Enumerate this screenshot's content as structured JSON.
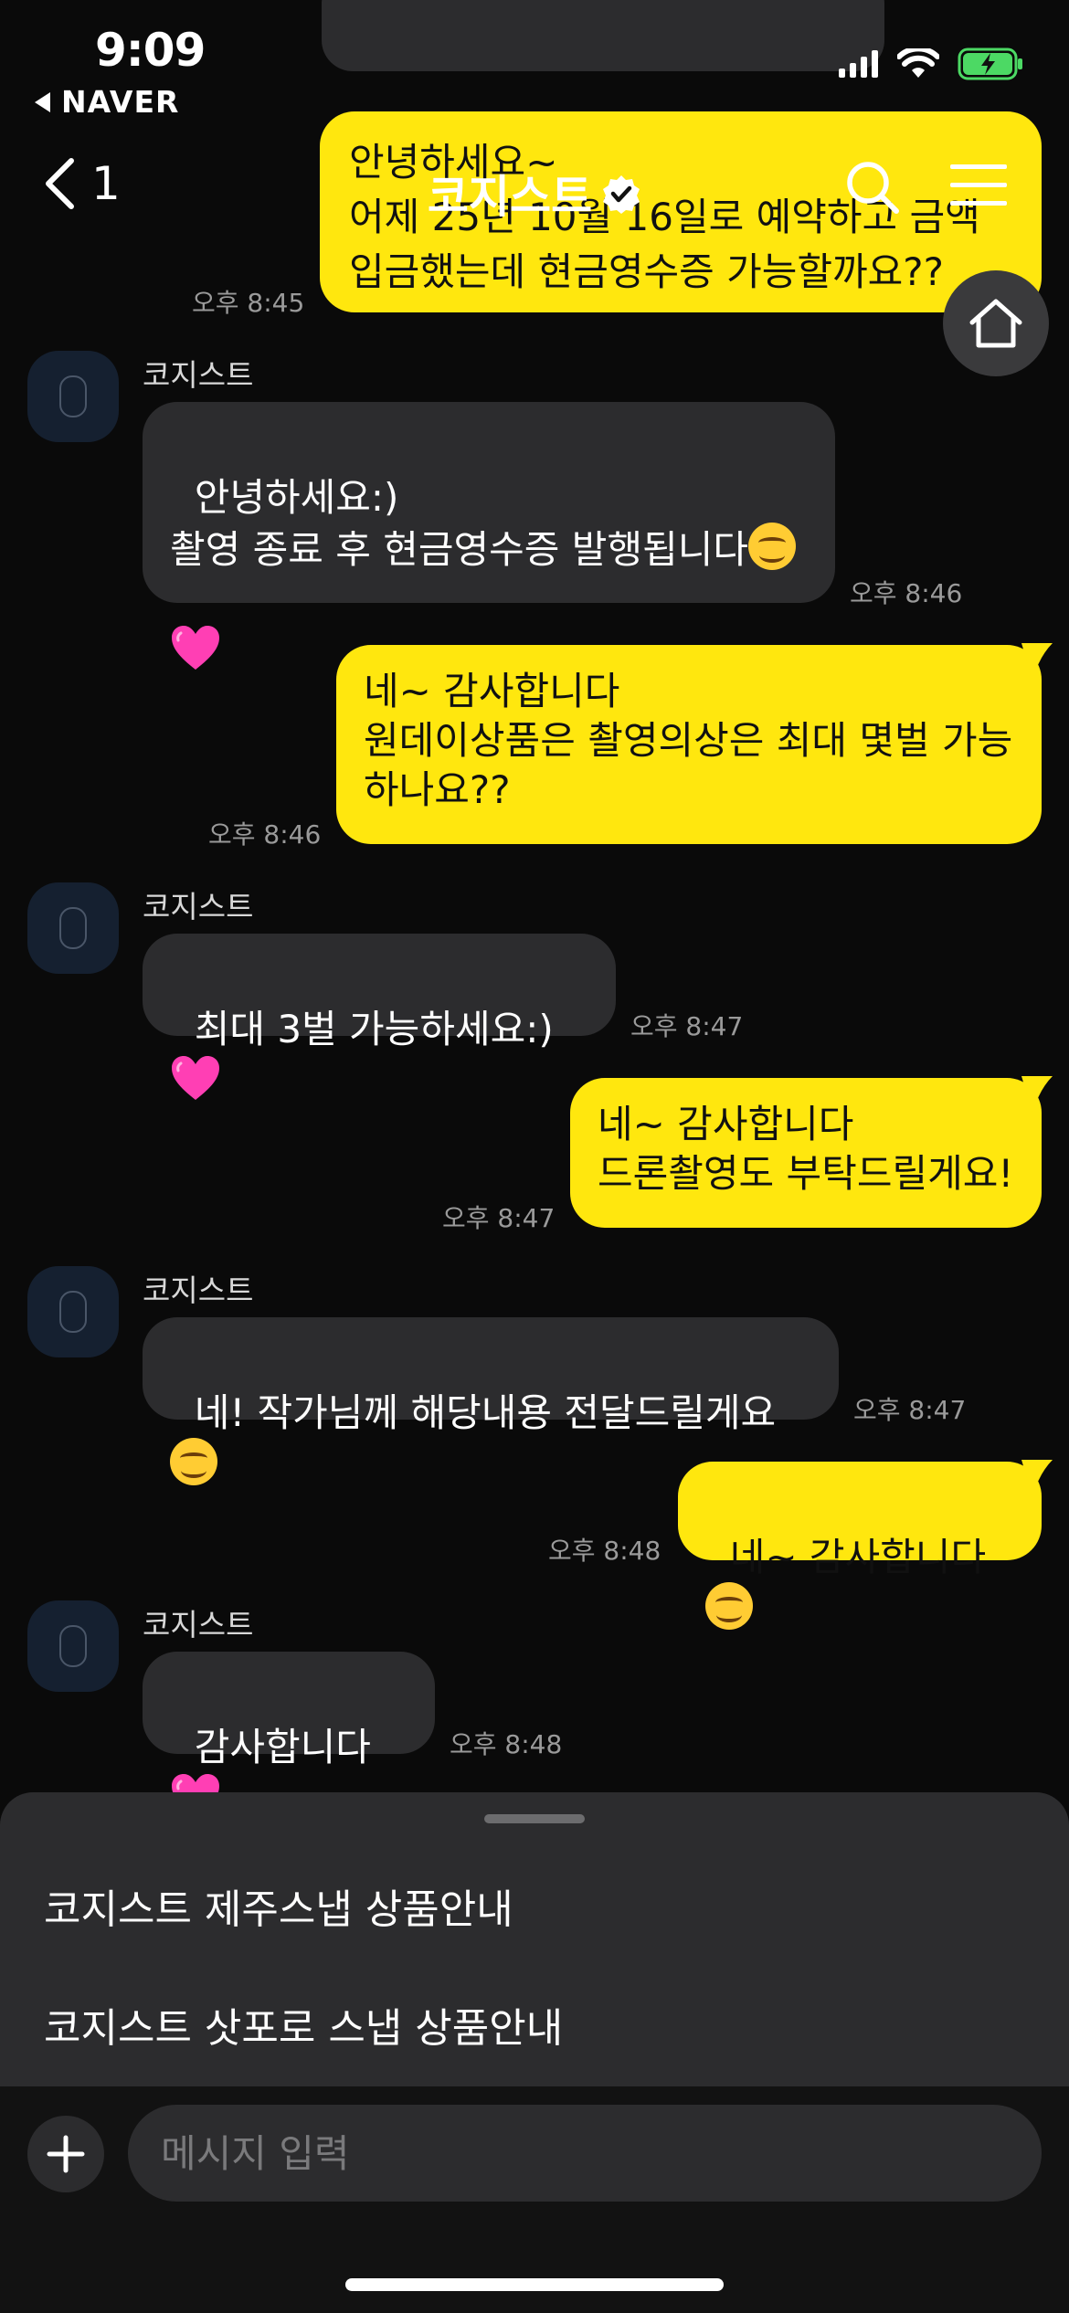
{
  "status": {
    "time": "9:09",
    "back_app": "NAVER"
  },
  "nav": {
    "back_count": "1",
    "title": "코지스트"
  },
  "messages": [
    {
      "text": "안녕하세요~\n어제 25년 10월 16일로 예약하고 금액입금했는데 현금영수증 가능할까요??",
      "time": "오후 8:45"
    },
    {
      "sender": "코지스트",
      "text": "안녕하세요:)\n촬영 종료 후 현금영수증 발행됩니다",
      "time": "오후 8:46"
    },
    {
      "text": "네~ 감사합니다\n원데이상품은 촬영의상은 최대 몇벌 가능하나요??",
      "time": "오후 8:46"
    },
    {
      "sender": "코지스트",
      "text": "최대 3벌 가능하세요:)",
      "time": "오후 8:47"
    },
    {
      "text": "네~ 감사합니다\n드론촬영도 부탁드릴게요!",
      "time": "오후 8:47"
    },
    {
      "sender": "코지스트",
      "text": "네! 작가님께 해당내용 전달드릴게요",
      "time": "오후 8:47"
    },
    {
      "text": "네~ 감사합니다",
      "time": "오후 8:48"
    },
    {
      "sender": "코지스트",
      "text": "감사합니다",
      "time": "오후 8:48"
    }
  ],
  "sheet": {
    "items": [
      "코지스트 제주스냅 상품안내",
      "코지스트 삿포로 스냅 상품안내"
    ]
  },
  "input": {
    "placeholder": "메시지 입력"
  },
  "colors": {
    "my_bubble": "#ffe70e",
    "their_bubble": "#2c2c2e",
    "background": "#0a0a0a"
  },
  "icons": [
    "back-chevron-icon",
    "verified-badge-icon",
    "search-icon",
    "hamburger-menu-icon",
    "home-icon",
    "plus-icon",
    "smile-emoji-icon",
    "pink-heart-emoji-icon",
    "signal-icon",
    "wifi-icon",
    "battery-charging-icon"
  ]
}
